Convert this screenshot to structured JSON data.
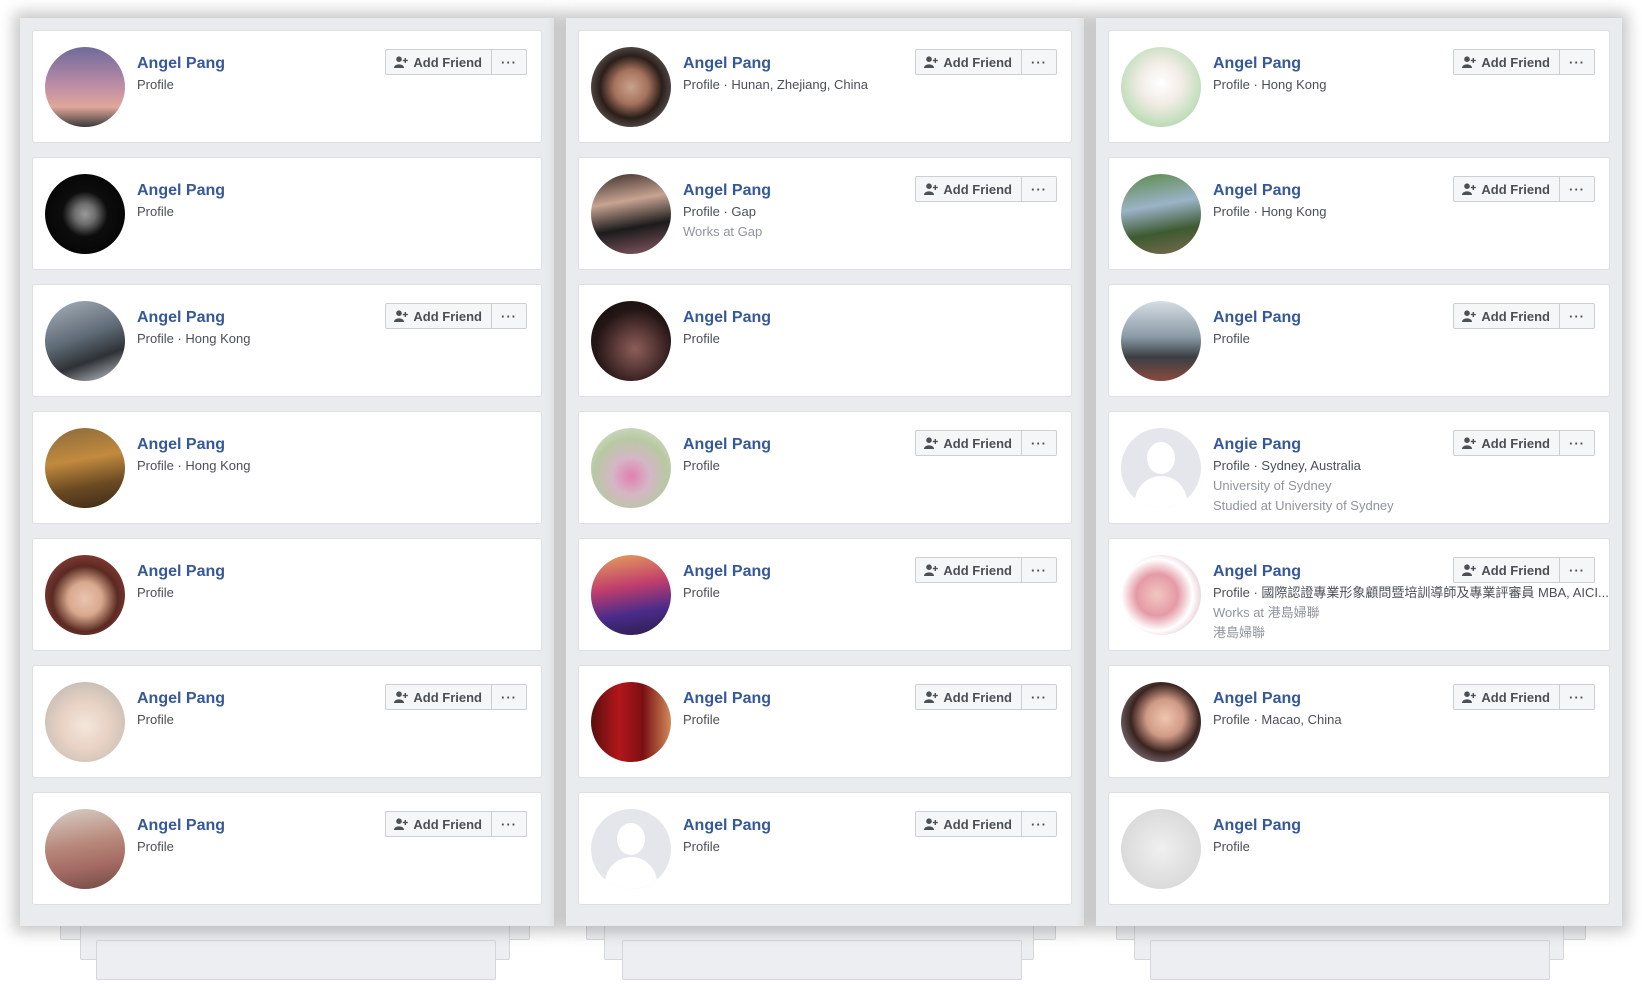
{
  "buttons": {
    "add_friend": "Add Friend",
    "more": "···"
  },
  "columns": [
    {
      "cards": [
        {
          "name": "Angel Pang",
          "lines": [
            "Profile"
          ],
          "has_add": true,
          "avatar": {
            "kind": "photo",
            "bg": "linear-gradient(180deg,#6f6a9a 0%,#b88aa6 45%,#e0a79a 75%,#3a3a3a 100%)"
          }
        },
        {
          "name": "Angel Pang",
          "lines": [
            "Profile"
          ],
          "has_add": false,
          "avatar": {
            "kind": "photo",
            "bg": "radial-gradient(circle at 50% 50%,#9a9a9a 0,#6e6e6e 18%,#0d0d0d 40%,#000 100%)"
          }
        },
        {
          "name": "Angel Pang",
          "lines": [
            "Profile · Hong Kong"
          ],
          "has_add": true,
          "avatar": {
            "kind": "photo",
            "bg": "linear-gradient(160deg,#a9b3bd 0%,#5f6b76 45%,#2e3236 70%,#c7ccd0 100%)"
          }
        },
        {
          "name": "Angel Pang",
          "lines": [
            "Profile · Hong Kong"
          ],
          "has_add": false,
          "avatar": {
            "kind": "photo",
            "bg": "linear-gradient(170deg,#8a6a3c 0%,#c28a3e 40%,#6b4a22 70%,#3b2a18 100%)"
          }
        },
        {
          "name": "Angel Pang",
          "lines": [
            "Profile"
          ],
          "has_add": false,
          "avatar": {
            "kind": "photo",
            "bg": "radial-gradient(circle at 50% 55%,#e9c4b0 0,#d9a98e 28%,#5a2a22 55%,#b04848 100%)"
          }
        },
        {
          "name": "Angel Pang",
          "lines": [
            "Profile"
          ],
          "has_add": true,
          "avatar": {
            "kind": "photo",
            "bg": "radial-gradient(circle at 50% 55%,#f4e6dc 0,#e8d2c4 40%,#cfc2b8 70%,#9c9086 100%)"
          }
        },
        {
          "name": "Angel Pang",
          "lines": [
            "Profile"
          ],
          "has_add": true,
          "avatar": {
            "kind": "photo",
            "bg": "linear-gradient(170deg,#d9cfc6 0%,#b7877a 45%,#a46a63 70%,#6f4a44 100%)"
          }
        }
      ]
    },
    {
      "cards": [
        {
          "name": "Angel Pang",
          "lines": [
            "Profile · Hunan, Zhejiang, China"
          ],
          "has_add": true,
          "avatar": {
            "kind": "photo",
            "bg": "radial-gradient(circle at 50% 50%,#caa28c 0,#a5725c 30%,#2b1e1a 55%,#8b8b8b 100%)"
          }
        },
        {
          "name": "Angel Pang",
          "lines": [
            "Profile · Gap",
            "Works at Gap"
          ],
          "has_add": true,
          "avatar": {
            "kind": "photo",
            "bg": "linear-gradient(170deg,#3a2c2a 0%,#c7a392 35%,#1b1b1b 65%,#8a5a66 100%)"
          }
        },
        {
          "name": "Angel Pang",
          "lines": [
            "Profile"
          ],
          "has_add": false,
          "avatar": {
            "kind": "photo",
            "bg": "radial-gradient(circle at 55% 60%,#8c5e5a 0,#5b3a38 30%,#241616 60%,#0e0808 100%)"
          }
        },
        {
          "name": "Angel Pang",
          "lines": [
            "Profile"
          ],
          "has_add": true,
          "avatar": {
            "kind": "photo",
            "bg": "radial-gradient(circle at 50% 60%,#e27fb0 0,#d5b6c5 30%,#b7c9a2 60%,#e8e4dc 100%)"
          }
        },
        {
          "name": "Angel Pang",
          "lines": [
            "Profile"
          ],
          "has_add": true,
          "avatar": {
            "kind": "photo",
            "bg": "linear-gradient(170deg,#e7a35a 0%,#c03d6d 40%,#4a2b8a 70%,#2a1d4a 100%)"
          }
        },
        {
          "name": "Angel Pang",
          "lines": [
            "Profile"
          ],
          "has_add": true,
          "avatar": {
            "kind": "photo",
            "bg": "linear-gradient(90deg,#5a0f0f 0%,#b3161b 35%,#7a1013 65%,#d28a5a 100%)"
          }
        },
        {
          "name": "Angel Pang",
          "lines": [
            "Profile"
          ],
          "has_add": true,
          "avatar": {
            "kind": "silhouette",
            "bg": "#e4e6eb"
          }
        }
      ]
    },
    {
      "cards": [
        {
          "name": "Angel Pang",
          "lines": [
            "Profile · Hong Kong"
          ],
          "has_add": true,
          "avatar": {
            "kind": "photo",
            "bg": "radial-gradient(circle at 50% 45%,#ffffff 0,#f2ece6 35%,#c7e0c0 65%,#9fc79a 100%)"
          }
        },
        {
          "name": "Angel Pang",
          "lines": [
            "Profile · Hong Kong"
          ],
          "has_add": true,
          "avatar": {
            "kind": "photo",
            "bg": "linear-gradient(170deg,#5c8a4a 0%,#9bb3c7 40%,#3d5a30 70%,#7a6a4e 100%)"
          }
        },
        {
          "name": "Angel Pang",
          "lines": [
            "Profile"
          ],
          "has_add": true,
          "avatar": {
            "kind": "photo",
            "bg": "linear-gradient(180deg,#d6dde3 0%,#8a9aa6 45%,#3a3f44 70%,#8a4a3e 100%)"
          }
        },
        {
          "name": "Angie Pang",
          "lines": [
            "Profile · Sydney, Australia",
            "University of Sydney",
            "Studied at University of Sydney"
          ],
          "has_add": true,
          "avatar": {
            "kind": "silhouette",
            "bg": "#e4e6eb"
          }
        },
        {
          "name": "Angel Pang",
          "lines": [
            "Profile · 國際認證專業形象顧問暨培訓導師及專業評審員 MBA, AICI...",
            "Works at 港島婦聯",
            "港島婦聯"
          ],
          "has_add": true,
          "avatar": {
            "kind": "photo",
            "bg": "radial-gradient(circle at 45% 50%,#f0c8c0 0,#e59aa6 35%,#ffffff 60%,#c78a9a 100%)"
          }
        },
        {
          "name": "Angel Pang",
          "lines": [
            "Profile · Macao, China"
          ],
          "has_add": true,
          "avatar": {
            "kind": "photo",
            "bg": "radial-gradient(circle at 55% 45%,#f0c6b0 0,#d09a86 30%,#3a2420 55%,#b7b1c7 100%)"
          }
        },
        {
          "name": "Angel Pang",
          "lines": [
            "Profile"
          ],
          "has_add": false,
          "avatar": {
            "kind": "photo",
            "bg": "radial-gradient(circle at 50% 50%,#f0f0f0 0,#e2e2e2 45%,#d2d2d2 100%)"
          }
        }
      ]
    }
  ]
}
